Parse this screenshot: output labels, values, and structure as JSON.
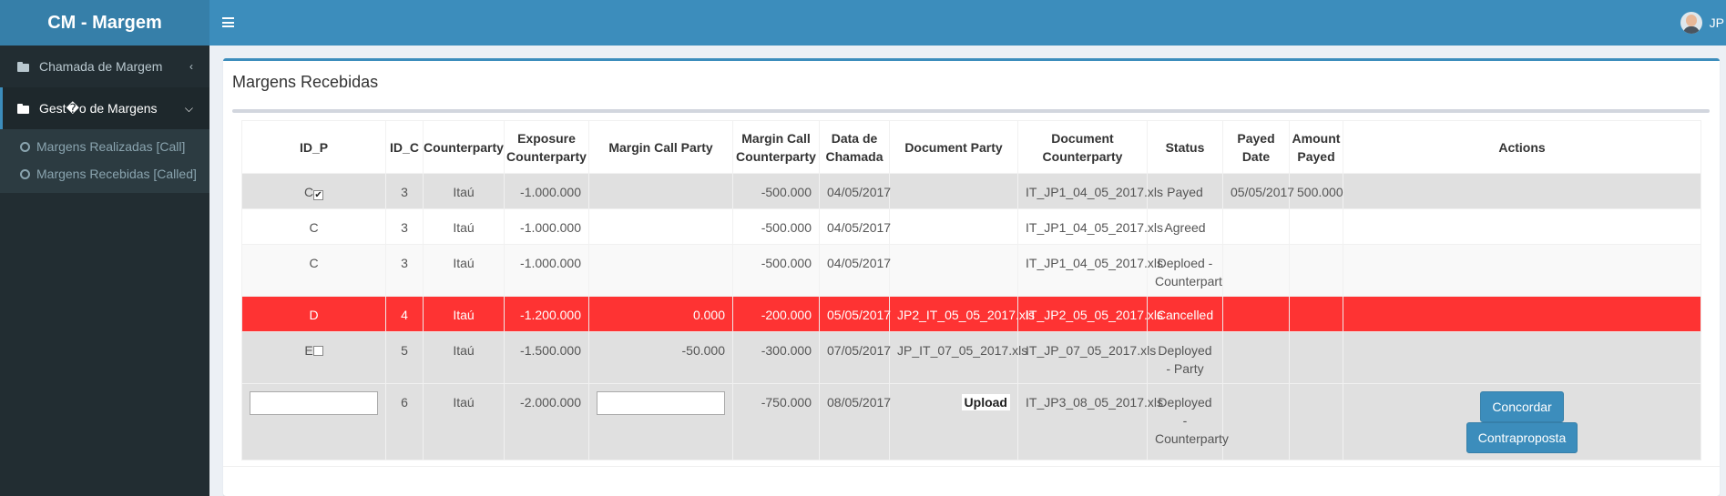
{
  "app": {
    "title": "CM - Margem"
  },
  "user": {
    "name": "JP"
  },
  "sidebar": {
    "items": [
      {
        "label": "Chamada de Margem"
      },
      {
        "label": "Gest�o de Margens"
      }
    ],
    "subitems": [
      {
        "label": "Margens Realizadas [Call]"
      },
      {
        "label": "Margens Recebidas [Called]"
      }
    ]
  },
  "page": {
    "title": "Margens Recebidas"
  },
  "table": {
    "headers": [
      "ID_P",
      "ID_C",
      "Counterparty",
      "Exposure Counterparty",
      "Margin Call Party",
      "Margin Call Counterparty",
      "Data de Chamada",
      "Document Party",
      "Document Counterparty",
      "Status",
      "Payed Date",
      "Amount Payed",
      "Actions"
    ],
    "rows": [
      {
        "id_p": "C",
        "id_c": "3",
        "counterparty": "Itaú",
        "exposure": "-1.000.000",
        "mc_party": "",
        "mc_counterparty": "-500.000",
        "date": "04/05/2017",
        "doc_party": "",
        "doc_counterparty": "IT_JP1_04_05_2017.xls",
        "status": "Payed",
        "payed_date": "05/05/2017",
        "amount_payed": "500.000"
      },
      {
        "id_p": "C",
        "id_c": "3",
        "counterparty": "Itaú",
        "exposure": "-1.000.000",
        "mc_party": "",
        "mc_counterparty": "-500.000",
        "date": "04/05/2017",
        "doc_party": "",
        "doc_counterparty": "IT_JP1_04_05_2017.xls",
        "status": "Agreed",
        "payed_date": "",
        "amount_payed": ""
      },
      {
        "id_p": "C",
        "id_c": "3",
        "counterparty": "Itaú",
        "exposure": "-1.000.000",
        "mc_party": "",
        "mc_counterparty": "-500.000",
        "date": "04/05/2017",
        "doc_party": "",
        "doc_counterparty": "IT_JP1_04_05_2017.xls",
        "status": "Deploed - Counterpart",
        "payed_date": "",
        "amount_payed": ""
      },
      {
        "id_p": "D",
        "id_c": "4",
        "counterparty": "Itaú",
        "exposure": "-1.200.000",
        "mc_party": "0.000",
        "mc_counterparty": "-200.000",
        "date": "05/05/2017",
        "doc_party": "JP2_IT_05_05_2017.xls",
        "doc_counterparty": "IT_JP2_05_05_2017.xls",
        "status": "Cancelled",
        "payed_date": "",
        "amount_payed": ""
      },
      {
        "id_p": "E",
        "id_c": "5",
        "counterparty": "Itaú",
        "exposure": "-1.500.000",
        "mc_party": "-50.000",
        "mc_counterparty": "-300.000",
        "date": "07/05/2017",
        "doc_party": "JP_IT_07_05_2017.xls",
        "doc_counterparty": "IT_JP_07_05_2017.xls",
        "status": "Deployed - Party",
        "payed_date": "",
        "amount_payed": ""
      },
      {
        "id_p": "",
        "id_c": "6",
        "counterparty": "Itaú",
        "exposure": "-2.000.000",
        "mc_party": "",
        "mc_counterparty": "-750.000",
        "date": "08/05/2017",
        "doc_party": "Upload",
        "doc_counterparty": "IT_JP3_08_05_2017.xls",
        "status": "Deployed - Counterparty",
        "payed_date": "",
        "amount_payed": ""
      }
    ],
    "actions": {
      "agree": "Concordar",
      "counter": "Contraproposta"
    }
  },
  "colors": {
    "header": "#3c8dbc",
    "logo": "#367fa9",
    "sidebar": "#222d32",
    "cancelled_row": "#fe3333"
  }
}
